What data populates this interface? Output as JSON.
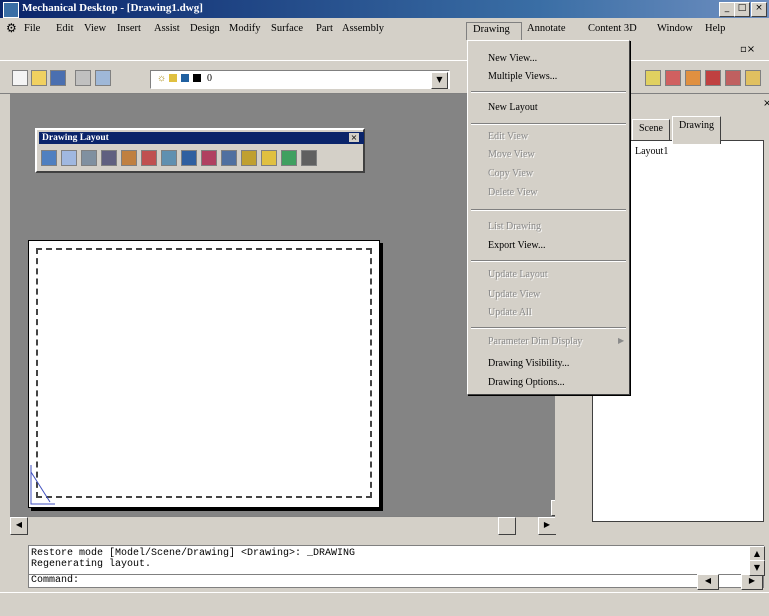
{
  "window": {
    "title": "Mechanical Desktop - [Drawing1.dwg]",
    "controls": [
      "_",
      "□",
      "×"
    ]
  },
  "menubar": {
    "items": [
      "File",
      "Edit",
      "View",
      "Insert",
      "Assist",
      "Design",
      "Modify",
      "Surface",
      "Part",
      "Assembly",
      "Drawing",
      "Annotate",
      "Content 3D",
      "Window",
      "Help"
    ],
    "active": "Drawing"
  },
  "toolbar": {
    "layer_value": "0"
  },
  "float_toolbar": {
    "title": "Drawing Layout"
  },
  "dropdown": {
    "items": [
      {
        "label": "New View...",
        "enabled": true
      },
      {
        "label": "Multiple Views...",
        "enabled": true
      },
      {
        "label": "New Layout",
        "enabled": true
      },
      {
        "label": "Edit View",
        "enabled": false
      },
      {
        "label": "Move View",
        "enabled": false
      },
      {
        "label": "Copy View",
        "enabled": false
      },
      {
        "label": "Delete View",
        "enabled": false
      },
      {
        "label": "List Drawing",
        "enabled": false
      },
      {
        "label": "Export View...",
        "enabled": true
      },
      {
        "label": "Update Layout",
        "enabled": false
      },
      {
        "label": "Update View",
        "enabled": false
      },
      {
        "label": "Update All",
        "enabled": false
      },
      {
        "label": "Parameter Dim Display",
        "enabled": false
      },
      {
        "label": "Drawing Visibility...",
        "enabled": true
      },
      {
        "label": "Drawing Options...",
        "enabled": true
      }
    ]
  },
  "browser": {
    "tabs": [
      "Scene",
      "Drawing"
    ],
    "active_tab": "Drawing",
    "tree": [
      "Layout1"
    ]
  },
  "command": {
    "lines": [
      "Restore mode [Model/Scene/Drawing] <Drawing>: _DRAWING",
      "Regenerating layout."
    ],
    "prompt": "Command:"
  }
}
